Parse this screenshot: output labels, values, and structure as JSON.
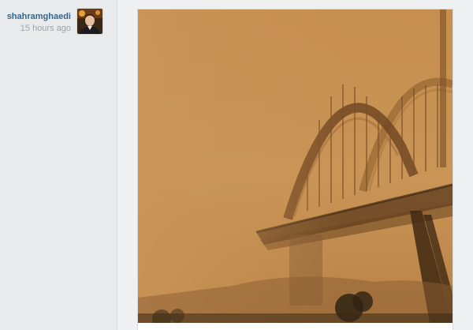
{
  "post": {
    "author": {
      "username": "shahramghaedi",
      "time_ago": "15 hours ago",
      "avatar_icon": "user-avatar"
    },
    "photo": {
      "subject": "photo"
    }
  },
  "colors": {
    "username": "#33678f",
    "timestamp": "#9ea2a8",
    "sky": "#c99456"
  }
}
